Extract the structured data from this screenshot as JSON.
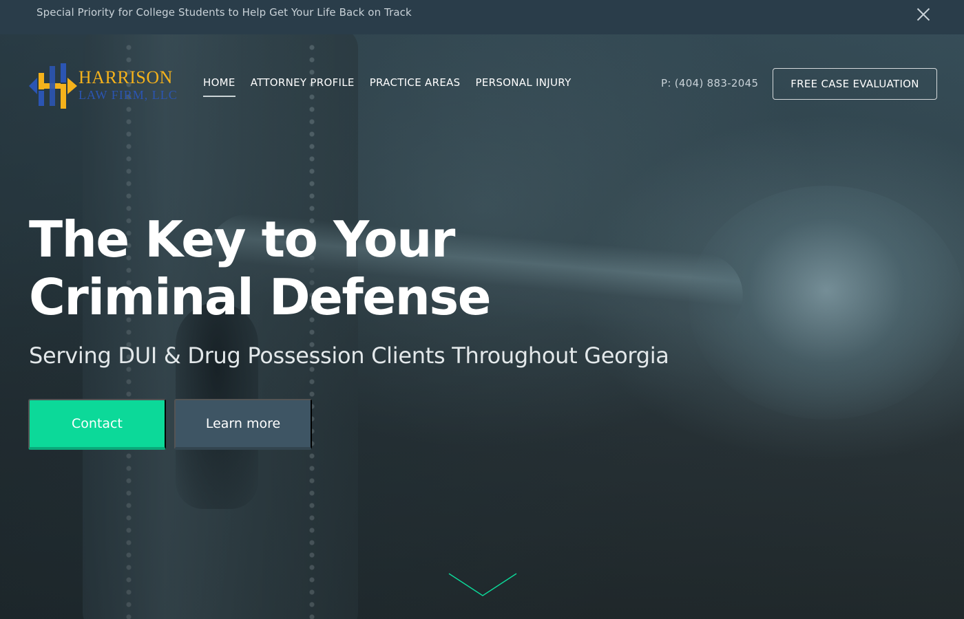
{
  "announcement": {
    "text": "Special Priority for College Students to Help Get Your Life Back on Track",
    "close_icon": "close-icon"
  },
  "logo": {
    "name": "HARRISON",
    "sub": "LAW FIRM, LLC",
    "colors": {
      "gold": "#f5b21b",
      "blue": "#2b55b3"
    }
  },
  "nav": {
    "items": [
      {
        "label": "HOME",
        "active": true
      },
      {
        "label": "ATTORNEY PROFILE",
        "active": false
      },
      {
        "label": "PRACTICE AREAS",
        "active": false
      },
      {
        "label": "PERSONAL INJURY",
        "active": false
      }
    ]
  },
  "header": {
    "phone": "P: (404) 883-2045",
    "cta_label": "FREE CASE EVALUATION"
  },
  "hero": {
    "title_line1": "The Key to Your",
    "title_line2": "Criminal Defense",
    "subtitle": "Serving DUI & Drug Possession Clients Throughout Georgia",
    "primary_button": "Contact",
    "secondary_button": "Learn more",
    "scroll_icon": "chevron-down-icon"
  },
  "colors": {
    "announcement_bg": "#2a3d4a",
    "accent_green": "#0cd999",
    "secondary_button_bg": "#3e5564"
  }
}
